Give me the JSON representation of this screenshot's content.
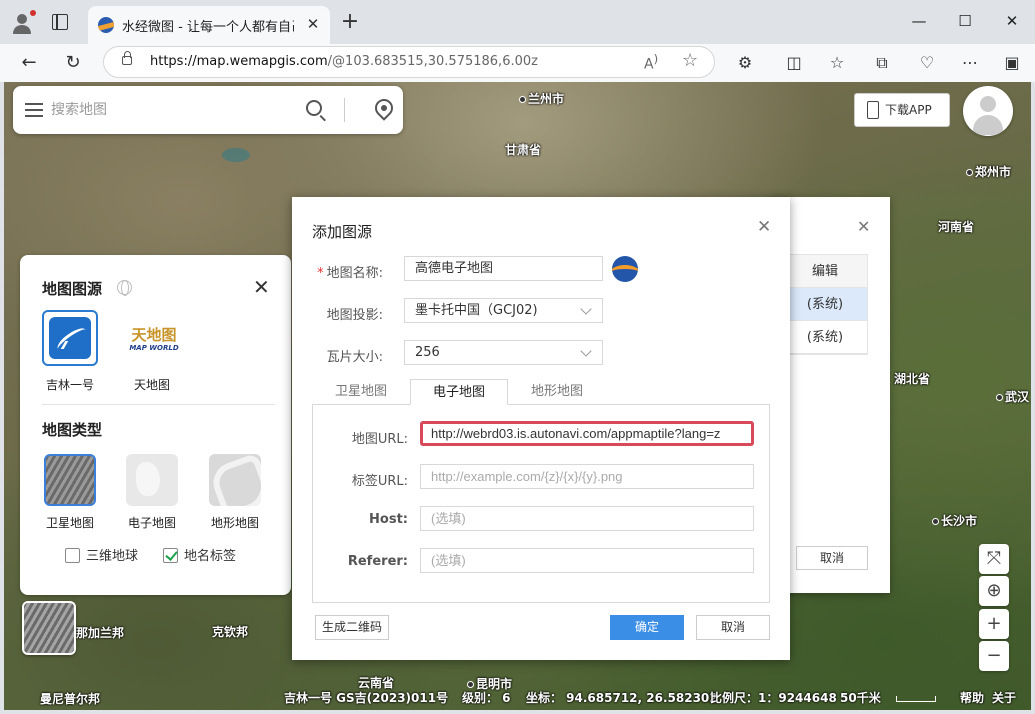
{
  "browser": {
    "tab_title": "水经微图 - 让每一个人都有自己的",
    "url_host": "https://map.wemapgis.com",
    "url_path": "/@103.683515,30.575186,6.00z"
  },
  "search": {
    "placeholder": "搜索地图"
  },
  "header": {
    "download_app": "下载APP"
  },
  "map_labels": [
    {
      "text": "兰州市",
      "dot": true
    },
    {
      "text": "甘肃省",
      "dot": false
    },
    {
      "text": "郑州市",
      "dot": true
    },
    {
      "text": "河南省",
      "dot": false
    },
    {
      "text": "湖北省",
      "dot": false
    },
    {
      "text": "武汉",
      "dot": true
    },
    {
      "text": "长沙市",
      "dot": true
    },
    {
      "text": "那加兰邦",
      "dot": false
    },
    {
      "text": "克钦邦",
      "dot": false
    },
    {
      "text": "云南省",
      "dot": false
    },
    {
      "text": "昆明市",
      "dot": true
    },
    {
      "text": "曼尼普尔邦",
      "dot": false
    }
  ],
  "source_panel": {
    "title": "地图图源",
    "sources": [
      {
        "label": "吉林一号"
      },
      {
        "label": "天地图",
        "logo_cn": "天地图",
        "logo_en": "MAP WORLD"
      }
    ],
    "type_title": "地图类型",
    "types": [
      {
        "label": "卫星地图",
        "selected": true
      },
      {
        "label": "电子地图",
        "selected": false
      },
      {
        "label": "地形地图",
        "selected": false
      }
    ],
    "checkboxes": [
      {
        "label": "三维地球",
        "checked": false
      },
      {
        "label": "地名标签",
        "checked": true
      }
    ]
  },
  "background_dialog": {
    "column_header": "编辑",
    "rows": [
      "(系统)",
      "(系统)"
    ],
    "cancel": "取消"
  },
  "dialog": {
    "title": "添加图源",
    "fields": {
      "name_label": "地图名称:",
      "name_value": "高德电子地图",
      "projection_label": "地图投影:",
      "projection_value": "墨卡托中国（GCJ02)",
      "tile_label": "瓦片大小:",
      "tile_value": "256"
    },
    "tabs": [
      {
        "label": "卫星地图",
        "active": false
      },
      {
        "label": "电子地图",
        "active": true
      },
      {
        "label": "地形地图",
        "active": false
      }
    ],
    "panel": {
      "map_url_label": "地图URL:",
      "map_url_value": "http://webrd03.is.autonavi.com/appmaptile?lang=z",
      "label_url_label": "标签URL:",
      "label_url_placeholder": "http://example.com/{z}/{x}/{y}.png",
      "host_label": "Host:",
      "host_placeholder": "(选填)",
      "referer_label": "Referer:",
      "referer_placeholder": "(选填)"
    },
    "qr_button": "生成二维码",
    "ok_button": "确定",
    "cancel_button": "取消"
  },
  "status_bar": {
    "copyright": "吉林一号 GS吉(2023)011号",
    "level": "级别： 6",
    "coord": "坐标：  94.685712, 26.582302",
    "scale": "比例尺：1：9244648",
    "scale_len": "50千米",
    "help": "帮助",
    "about": "关于"
  },
  "colors": {
    "primary": "#3b8ee6",
    "highlight_border": "#d84a5a",
    "required": "#e03030"
  }
}
